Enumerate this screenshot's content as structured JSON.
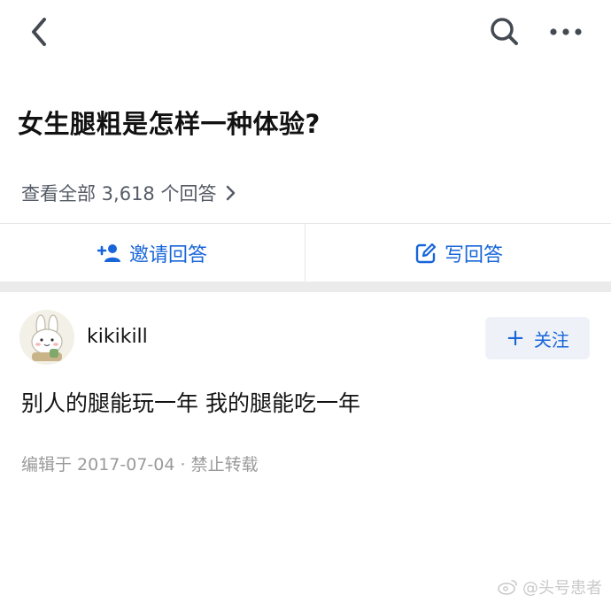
{
  "nav": {
    "back_icon": "chevron-left-icon",
    "search_icon": "search-icon",
    "more_icon": "more-horizontal-icon"
  },
  "question": {
    "title": "女生腿粗是怎样一种体验?",
    "answers_link": "查看全部 3,618 个回答"
  },
  "actions": {
    "invite_label": "邀请回答",
    "write_label": "写回答"
  },
  "answer": {
    "author": "kikikill",
    "follow_label": "关注",
    "text": "别人的腿能玩一年 我的腿能吃一年",
    "meta": "编辑于 2017-07-04 · 禁止转载"
  },
  "watermark": {
    "text": "@头号患者"
  },
  "colors": {
    "accent": "#1765d9",
    "follow_bg": "#eef2f8",
    "divider": "#e6e6e6",
    "gap": "#ebebeb",
    "muted": "#9a9a9a"
  }
}
